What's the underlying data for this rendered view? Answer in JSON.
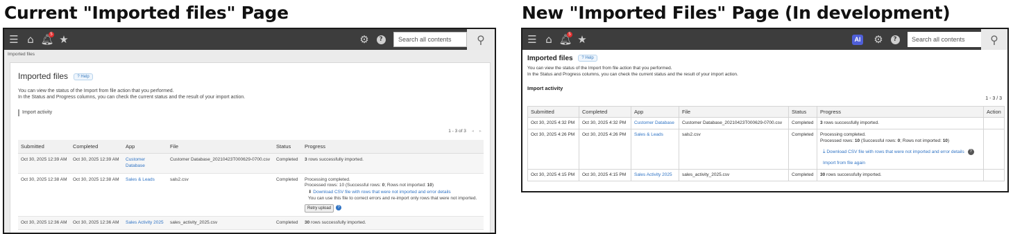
{
  "titles": {
    "current": "Current \"Imported files\" Page",
    "new": "New \"Imported Files\" Page (In development)"
  },
  "topbar": {
    "search_placeholder": "Search all contents",
    "notification_count": "5",
    "ai_label": "AI"
  },
  "current": {
    "breadcrumb": "Imported files",
    "heading": "Imported files",
    "help": "? Help",
    "desc1": "You can view the status of the Import from file action that you performed.",
    "desc2": "In the Status and Progress columns, you can check the current status and the result of your import action.",
    "section": "Import activity",
    "pagination": "1 - 3 of 3",
    "pager_prev": "◆",
    "pager_next": "◆",
    "columns": [
      "Submitted",
      "Completed",
      "App",
      "File",
      "Status",
      "Progress"
    ],
    "rows": [
      {
        "submitted": "Oct 30, 2025 12:39 AM",
        "completed": "Oct 30, 2025 12:39 AM",
        "app": "Customer Database",
        "file": "Customer Database_20210423T000629-0700.csv",
        "status": "Completed",
        "progress_bold": "3",
        "progress_text": " rows successfully imported."
      },
      {
        "submitted": "Oct 30, 2025 12:38 AM",
        "completed": "Oct 30, 2025 12:38 AM",
        "app": "Sales & Leads",
        "file": "sals2.csv",
        "status": "Completed",
        "p1": "Processing completed.",
        "p2a": "Processed rows: 10 (Successful rows: ",
        "p2b": "0",
        "p2c": "; Rows not imported: ",
        "p2d": "10",
        "p2e": ")",
        "download": "Download CSV file with rows that were not imported and error details",
        "note": "You can use this file to correct errors and re-import only rows that were not imported.",
        "retry": "Retry upload"
      },
      {
        "submitted": "Oct 30, 2025 12:36 AM",
        "completed": "Oct 30, 2025 12:36 AM",
        "app": "Sales Activity 2025",
        "file": "sales_activity_2025.csv",
        "status": "Completed",
        "progress_bold": "30",
        "progress_text": " rows successfully imported."
      }
    ]
  },
  "new": {
    "heading": "Imported files",
    "help": "? Help",
    "desc1": "You can view the status of the Import from file action that you performed.",
    "desc2": "In the Status and Progress columns, you can check the current status and the result of your import action.",
    "section": "Import activity",
    "pagination": "1 - 3 / 3",
    "columns": [
      "Submitted",
      "Completed",
      "App",
      "File",
      "Status",
      "Progress",
      "Action"
    ],
    "rows": [
      {
        "submitted": "Oct 30, 2025 4:32 PM",
        "completed": "Oct 30, 2025 4:32 PM",
        "app": "Customer Database",
        "file": "Customer Database_20210423T000629-0700.csv",
        "status": "Completed",
        "progress_bold": "3",
        "progress_text": " rows successfully imported."
      },
      {
        "submitted": "Oct 30, 2025 4:26 PM",
        "completed": "Oct 30, 2025 4:26 PM",
        "app": "Sales & Leads",
        "file": "sals2.csv",
        "status": "Completed",
        "p1": "Processing completed.",
        "p2a": "Processed rows: ",
        "p2b": "10",
        "p2c": " (Successful rows: ",
        "p2d": "0",
        "p2e": "; Rows not imported: ",
        "p2f": "10",
        "p2g": ")",
        "download": "Download CSV file with rows that were not imported and error details",
        "import_again": "Import from file again"
      },
      {
        "submitted": "Oct 30, 2025 4:15 PM",
        "completed": "Oct 30, 2025 4:15 PM",
        "app": "Sales Activity 2025",
        "file": "sales_activity_2025.csv",
        "status": "Completed",
        "progress_bold": "30",
        "progress_text": " rows successfully imported."
      }
    ]
  }
}
